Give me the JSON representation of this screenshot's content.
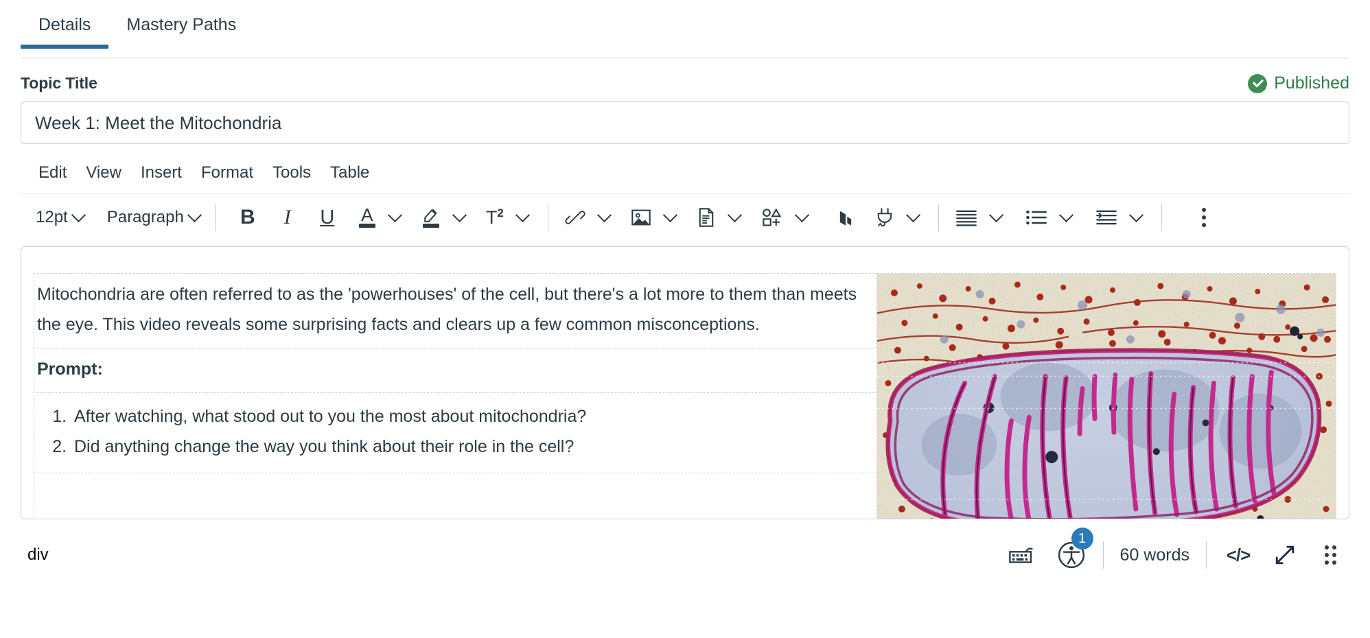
{
  "tabs": [
    {
      "label": "Details",
      "active": true
    },
    {
      "label": "Mastery Paths",
      "active": false
    }
  ],
  "title_section": {
    "label": "Topic Title",
    "input_value": "Week 1: Meet the Mitochondria",
    "input_placeholder": "Topic Title"
  },
  "publish_status": {
    "label": "Published",
    "color": "#2E7D47",
    "icon": "check-circle-icon"
  },
  "menubar": [
    {
      "label": "Edit"
    },
    {
      "label": "View"
    },
    {
      "label": "Insert"
    },
    {
      "label": "Format"
    },
    {
      "label": "Tools"
    },
    {
      "label": "Table"
    }
  ],
  "toolbar": {
    "font_size": "12pt",
    "block_format": "Paragraph",
    "buttons": [
      {
        "name": "bold-button",
        "glyph": "B"
      },
      {
        "name": "italic-button",
        "glyph": "I"
      },
      {
        "name": "underline-button",
        "glyph": "U"
      },
      {
        "name": "text-color-button",
        "glyph": "A"
      },
      {
        "name": "highlight-button",
        "glyph": "highlighter-icon"
      },
      {
        "name": "superscript-button",
        "glyph": "T2"
      },
      {
        "name": "link-button",
        "glyph": "link-icon"
      },
      {
        "name": "image-button",
        "glyph": "image-icon"
      },
      {
        "name": "document-button",
        "glyph": "document-icon"
      },
      {
        "name": "media-button",
        "glyph": "shapes-icon"
      },
      {
        "name": "lti-apps-button",
        "glyph": "apps-icon"
      },
      {
        "name": "plugin-button",
        "glyph": "plug-icon"
      },
      {
        "name": "align-button",
        "glyph": "align-icon"
      },
      {
        "name": "bullet-list-button",
        "glyph": "bullet-list-icon"
      },
      {
        "name": "indent-button",
        "glyph": "indent-icon"
      },
      {
        "name": "overflow-button",
        "glyph": "kebab-icon"
      }
    ]
  },
  "editor_content": {
    "paragraph": "Mitochondria are often referred to as the 'powerhouses' of the cell, but there's a lot more to them than meets the eye. This video reveals some surprising facts and clears up a few common misconceptions.",
    "prompt_heading": "Prompt:",
    "questions": [
      "After watching, what stood out to you the most about mitochondria?",
      "Did anything change the way you think about their role in the cell?"
    ],
    "image_alt": "Electron micrograph of a mitochondrion showing pink cristae and blue matrix"
  },
  "statusbar": {
    "element_path": "div",
    "word_count": "60 words",
    "accessibility_issue_count": "1",
    "keyboard_icon": "keyboard-icon",
    "accessibility_icon": "accessibility-icon",
    "html_editor_glyph": "</>",
    "resize_icon": "resize-arrow-icon",
    "drag_handle_icon": "drag-handle-icon"
  },
  "colors": {
    "accent_blue": "#2D6A8E",
    "badge_blue": "#2B7ABC",
    "published_green": "#2E7D47",
    "text": "#2D3B45",
    "border": "#C7CDD1"
  }
}
